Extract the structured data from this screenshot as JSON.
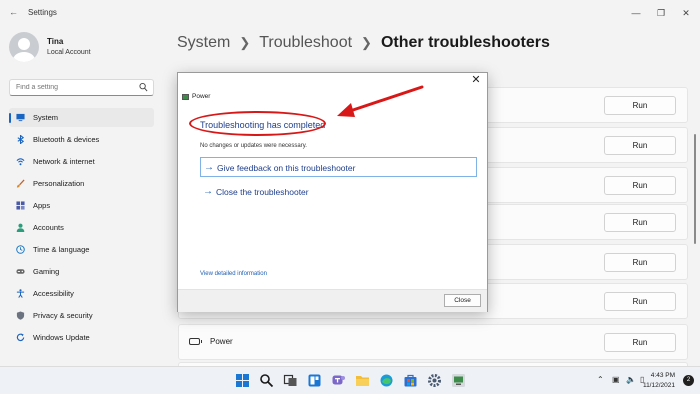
{
  "app": {
    "title": "Settings"
  },
  "user": {
    "name": "Tina",
    "account_type": "Local Account"
  },
  "search": {
    "placeholder": "Find a setting"
  },
  "sidebar": {
    "items": [
      {
        "label": "System",
        "icon": "monitor-icon",
        "selected": true
      },
      {
        "label": "Bluetooth & devices",
        "icon": "bluetooth-icon"
      },
      {
        "label": "Network & internet",
        "icon": "wifi-icon"
      },
      {
        "label": "Personalization",
        "icon": "brush-icon"
      },
      {
        "label": "Apps",
        "icon": "apps-icon"
      },
      {
        "label": "Accounts",
        "icon": "person-icon"
      },
      {
        "label": "Time & language",
        "icon": "globe-clock-icon"
      },
      {
        "label": "Gaming",
        "icon": "gamepad-icon"
      },
      {
        "label": "Accessibility",
        "icon": "accessibility-icon"
      },
      {
        "label": "Privacy & security",
        "icon": "shield-icon"
      },
      {
        "label": "Windows Update",
        "icon": "update-icon"
      }
    ]
  },
  "breadcrumb": {
    "items": [
      "System",
      "Troubleshoot",
      "Other troubleshooters"
    ]
  },
  "troubleshooters": {
    "run_label": "Run",
    "power_label": "Power"
  },
  "dialog": {
    "title": "Power",
    "status": "Troubleshooting has completed",
    "message": "No changes or updates were necessary.",
    "links": [
      "Give feedback on this troubleshooter",
      "Close the troubleshooter"
    ],
    "detail_link": "View detailed information",
    "close_button": "Close"
  },
  "taskbar": {
    "time": "4:43 PM",
    "date": "11/12/2021",
    "notification_count": "2"
  },
  "colors": {
    "accent": "#1a64c2",
    "annotation": "#d81818",
    "link": "#1f3f8c"
  }
}
